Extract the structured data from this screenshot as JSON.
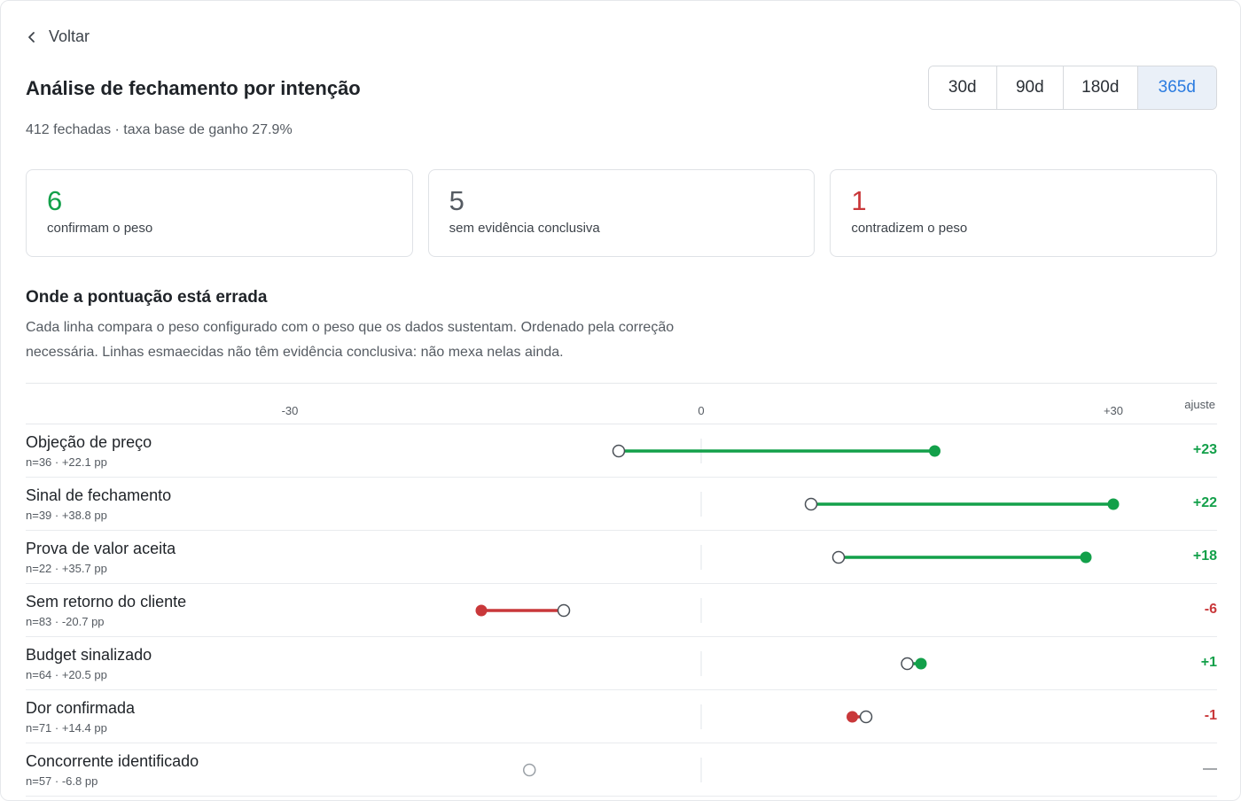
{
  "nav": {
    "back_label": "Voltar"
  },
  "header": {
    "title": "Análise de fechamento por intenção",
    "subtitle": "412 fechadas · taxa base de ganho 27.9%"
  },
  "range_selector": {
    "options": [
      "30d",
      "90d",
      "180d",
      "365d"
    ],
    "selected": "365d"
  },
  "summary_cards": [
    {
      "value": "6",
      "label": "confirmam o peso",
      "color": "#13a04a"
    },
    {
      "value": "5",
      "label": "sem evidência conclusiva",
      "color": "#555b62"
    },
    {
      "value": "1",
      "label": "contradizem o peso",
      "color": "#c9383a"
    }
  ],
  "section": {
    "title": "Onde a pontuação está errada",
    "description": "Cada linha compara o peso configurado com o peso que os dados sustentam. Ordenado pela correção necessária. Linhas esmaecidas não têm evidência conclusiva: não mexa nelas ainda."
  },
  "colors": {
    "positive": "#13a04a",
    "negative": "#c9383a",
    "axis": "#e1e4e8"
  },
  "chart_data": {
    "type": "dumbbell",
    "x_ticks": [
      -30,
      0,
      30
    ],
    "x_tick_labels": [
      "-30",
      "0",
      "+30"
    ],
    "adjust_header": "ajuste",
    "rows": [
      {
        "name": "Objeção de preço",
        "meta": "n=36 · +22.1 pp",
        "configured": -6,
        "supported": 17,
        "adjust_label": "+23",
        "status": "positive"
      },
      {
        "name": "Sinal de fechamento",
        "meta": "n=39 · +38.8 pp",
        "configured": 8,
        "supported": 30,
        "adjust_label": "+22",
        "status": "positive"
      },
      {
        "name": "Prova de valor aceita",
        "meta": "n=22 · +35.7 pp",
        "configured": 10,
        "supported": 28,
        "adjust_label": "+18",
        "status": "positive"
      },
      {
        "name": "Sem retorno do cliente",
        "meta": "n=83 · -20.7 pp",
        "configured": -10,
        "supported": -16,
        "adjust_label": "-6",
        "status": "negative"
      },
      {
        "name": "Budget sinalizado",
        "meta": "n=64 · +20.5 pp",
        "configured": 15,
        "supported": 16,
        "adjust_label": "+1",
        "status": "positive"
      },
      {
        "name": "Dor confirmada",
        "meta": "n=71 · +14.4 pp",
        "configured": 12,
        "supported": 11,
        "adjust_label": "-1",
        "status": "negative"
      },
      {
        "name": "Concorrente identificado",
        "meta": "n=57 · -6.8 pp",
        "configured": -12.5,
        "supported": null,
        "adjust_label": "—",
        "status": "neutral"
      }
    ]
  }
}
